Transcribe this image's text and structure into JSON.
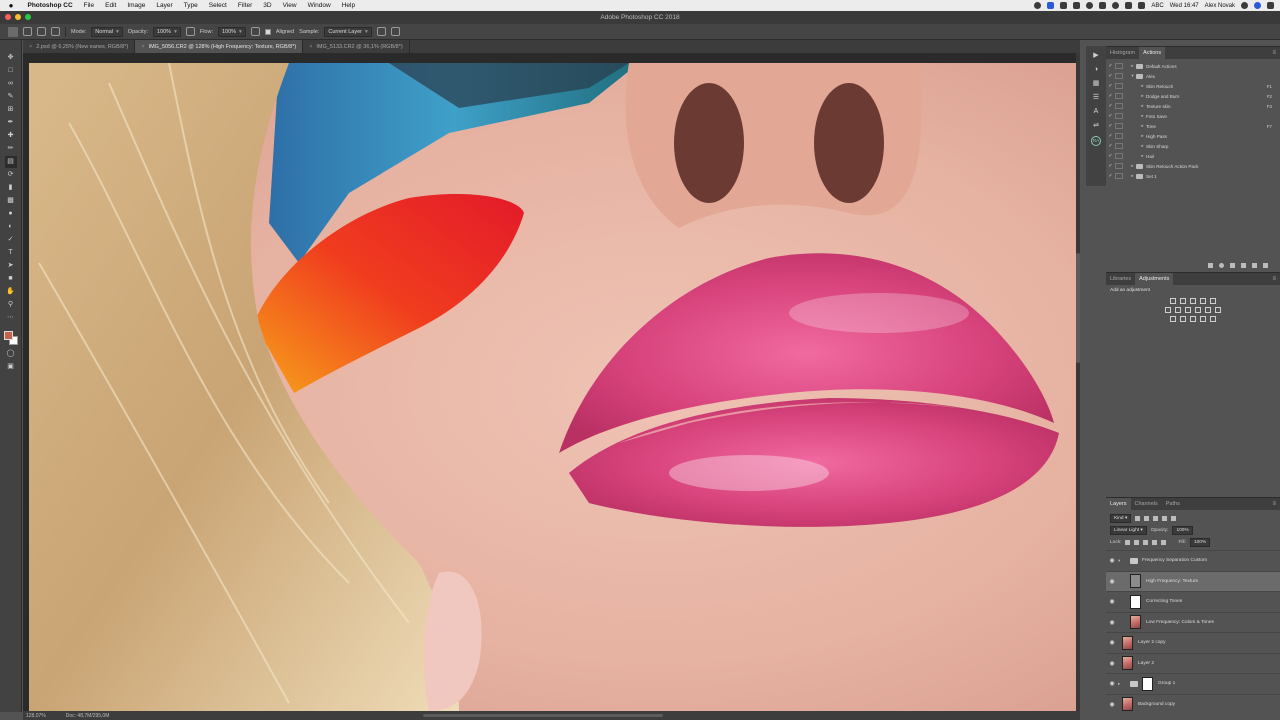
{
  "menubar": {
    "app_name": "Photoshop CC",
    "items": [
      "File",
      "Edit",
      "Image",
      "Layer",
      "Type",
      "Select",
      "Filter",
      "3D",
      "View",
      "Window",
      "Help"
    ],
    "input_label": "ABC",
    "clock": "Wed 16:47",
    "user": "Alex Novak"
  },
  "window": {
    "title": "Adobe Photoshop CC 2018"
  },
  "options": {
    "mode_label": "Mode:",
    "mode_value": "Normal",
    "opacity_label": "Opacity:",
    "opacity_value": "100%",
    "flow_label": "Flow:",
    "flow_value": "100%",
    "aligned_label": "Aligned",
    "sample_label": "Sample:",
    "sample_value": "Current Layer"
  },
  "doc_tabs": [
    {
      "label": "2.psd @ 6,25% (New eanes, RGB/8*)"
    },
    {
      "label": "IMG_5056.CR2 @ 128% (High Frequency: Texture, RGB/8*)"
    },
    {
      "label": "IMG_5133.CR2 @ 36,1% (RGB/8*)"
    }
  ],
  "status": {
    "zoom": "128,07%",
    "doc": "Doc: 48,7M/295,0M"
  },
  "actions_panel": {
    "tabs": [
      "Histogram",
      "Actions"
    ],
    "rows": [
      {
        "label": "Default Actions",
        "level": 0,
        "type": "set",
        "key": ""
      },
      {
        "label": "Alex",
        "level": 0,
        "type": "set-open",
        "key": ""
      },
      {
        "label": "Skin Retouch",
        "level": 1,
        "type": "action",
        "key": "F1"
      },
      {
        "label": "Dodge and Burn",
        "level": 1,
        "type": "action",
        "key": "F2"
      },
      {
        "label": "Texture skin",
        "level": 1,
        "type": "action",
        "key": "F3"
      },
      {
        "label": "Foto Save",
        "level": 1,
        "type": "action",
        "key": ""
      },
      {
        "label": "Tone",
        "level": 1,
        "type": "action",
        "key": "F7"
      },
      {
        "label": "High Pass",
        "level": 1,
        "type": "action",
        "key": ""
      },
      {
        "label": "Skin Sharp",
        "level": 1,
        "type": "action",
        "key": ""
      },
      {
        "label": "Hair",
        "level": 1,
        "type": "action",
        "key": ""
      },
      {
        "label": "Skin Retouch Action Pack",
        "level": 0,
        "type": "set",
        "key": ""
      },
      {
        "label": "Set 1",
        "level": 0,
        "type": "set",
        "key": ""
      }
    ]
  },
  "adjustments_panel": {
    "tabs": [
      "Libraries",
      "Adjustments"
    ],
    "heading": "Add an adjustment"
  },
  "layers_panel": {
    "tabs": [
      "Layers",
      "Channels",
      "Paths"
    ],
    "filter_label": "Kind",
    "blend_mode": "Linear Light",
    "opacity_label": "Opacity:",
    "opacity_value": "100%",
    "lock_label": "Lock:",
    "fill_label": "Fill:",
    "fill_value": "100%",
    "layers": [
      {
        "name": "Frequency Separation Custom",
        "thumb": "group",
        "selected": false,
        "indent": 0
      },
      {
        "name": "High Frequency: Texture",
        "thumb": "gray",
        "selected": true,
        "indent": 1
      },
      {
        "name": "Correcting Tones",
        "thumb": "white",
        "selected": false,
        "indent": 1
      },
      {
        "name": "Low Frequency: Colors & Tones",
        "thumb": "photo",
        "selected": false,
        "indent": 1
      },
      {
        "name": "Layer 2 copy",
        "thumb": "photo",
        "selected": false,
        "indent": 0
      },
      {
        "name": "Layer 2",
        "thumb": "photo",
        "selected": false,
        "indent": 0
      },
      {
        "name": "Group 1",
        "thumb": "group-mask",
        "selected": false,
        "indent": 0
      },
      {
        "name": "Background copy",
        "thumb": "photo",
        "selected": false,
        "indent": 0
      }
    ]
  },
  "colors": {
    "foreground": "#c2634b",
    "background": "#ffffff",
    "ui_dark": "#535353"
  }
}
